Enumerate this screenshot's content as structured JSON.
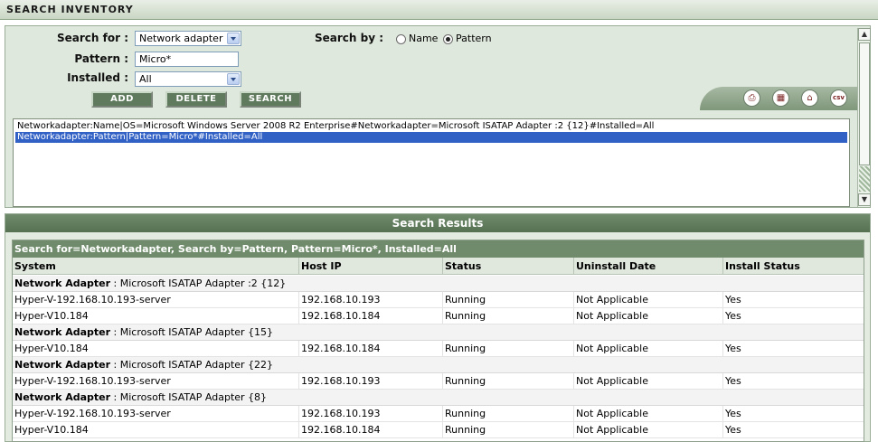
{
  "window": {
    "title": "SEARCH INVENTORY"
  },
  "form": {
    "search_for_label": "Search for :",
    "search_for_value": "Network adapter",
    "pattern_label": "Pattern :",
    "pattern_value": "Micro*",
    "installed_label": "Installed :",
    "installed_value": "All",
    "search_by_label": "Search by :",
    "radio_name": "Name",
    "radio_pattern": "Pattern",
    "selected_search_by": "Pattern"
  },
  "buttons": {
    "add": "ADD",
    "delete": "DELETE",
    "search": "SEARCH"
  },
  "icons": {
    "print": "printer-icon",
    "pdf": "pdf-icon",
    "home": "home-icon",
    "csv": "csv-icon",
    "csv_label": "csv"
  },
  "queries": [
    "Networkadapter:Name|OS=Microsoft Windows Server 2008 R2 Enterprise#Networkadapter=Microsoft ISATAP Adapter :2 {12}#Installed=All",
    "Networkadapter:Pattern|Pattern=Micro*#Installed=All"
  ],
  "results": {
    "header": "Search Results",
    "summary": "Search for=Networkadapter, Search by=Pattern, Pattern=Micro*, Installed=All",
    "columns": [
      "System",
      "Host IP",
      "Status",
      "Uninstall Date",
      "Install Status"
    ],
    "groups": [
      {
        "label": "Network Adapter",
        "value": ": Microsoft ISATAP Adapter :2 {12}",
        "rows": [
          [
            "Hyper-V-192.168.10.193-server",
            "192.168.10.193",
            "Running",
            "Not Applicable",
            "Yes"
          ],
          [
            "Hyper-V10.184",
            "192.168.10.184",
            "Running",
            "Not Applicable",
            "Yes"
          ]
        ]
      },
      {
        "label": "Network Adapter",
        "value": ": Microsoft ISATAP Adapter {15}",
        "rows": [
          [
            "Hyper-V10.184",
            "192.168.10.184",
            "Running",
            "Not Applicable",
            "Yes"
          ]
        ]
      },
      {
        "label": "Network Adapter",
        "value": ": Microsoft ISATAP Adapter {22}",
        "rows": [
          [
            "Hyper-V-192.168.10.193-server",
            "192.168.10.193",
            "Running",
            "Not Applicable",
            "Yes"
          ]
        ]
      },
      {
        "label": "Network Adapter",
        "value": ": Microsoft ISATAP Adapter {8}",
        "rows": [
          [
            "Hyper-V-192.168.10.193-server",
            "192.168.10.193",
            "Running",
            "Not Applicable",
            "Yes"
          ],
          [
            "Hyper-V10.184",
            "192.168.10.184",
            "Running",
            "Not Applicable",
            "Yes"
          ]
        ]
      }
    ]
  }
}
